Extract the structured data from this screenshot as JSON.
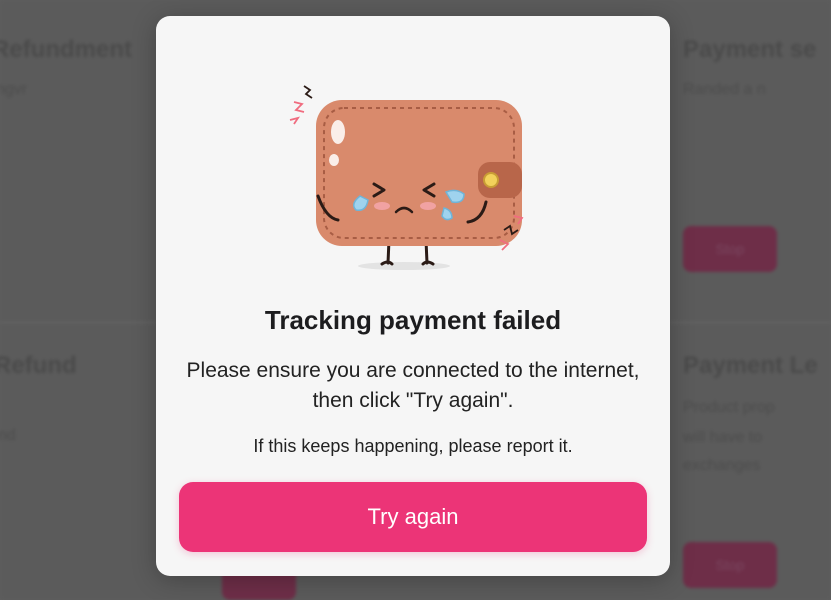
{
  "background": {
    "left_column": {
      "title_1": "Refundment",
      "text_1": "ngvr",
      "title_2": "Refund",
      "text_2": "nd"
    },
    "right_column": {
      "title_1": "Payment se",
      "text_1": "Randed a n",
      "button_1": "Stop",
      "title_2": "Payment Le",
      "text_2": [
        "Product prop",
        "will have to",
        "exchanges"
      ],
      "button_2": "Stop"
    }
  },
  "modal": {
    "illustration": "crying-wallet-illustration",
    "title": "Tracking payment failed",
    "message": "Please ensure you are connected to the internet, then click \"Try again\".",
    "note": "If this keeps happening, please report it.",
    "button_label": "Try again"
  },
  "colors": {
    "accent": "#ec3477",
    "wallet": "#d98a6c",
    "overlay": "#5b5b5b"
  }
}
